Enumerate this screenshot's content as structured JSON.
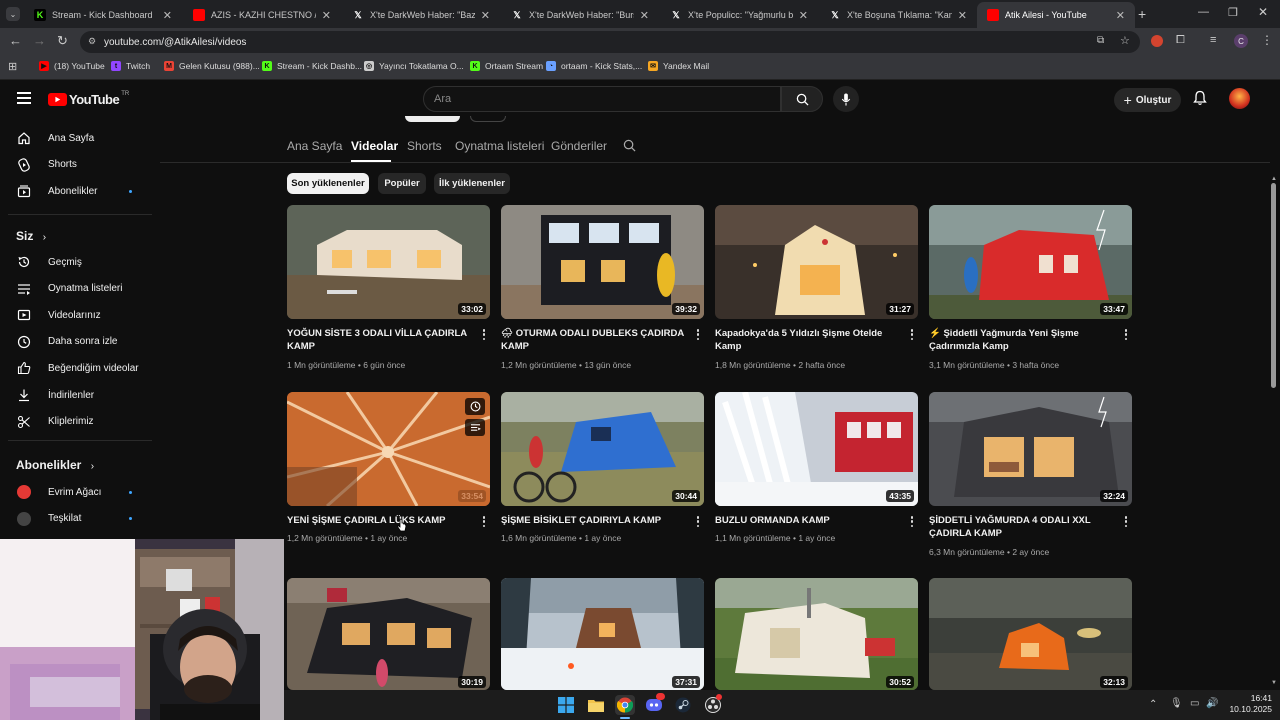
{
  "browser": {
    "tabs": [
      {
        "title": "Stream - Kick Dashboard",
        "icon": "kick-icon",
        "color": "#53fc18"
      },
      {
        "title": "AZIS - KAZHI CHESTNO / АЗИС",
        "icon": "youtube-icon",
        "color": "#ff0000"
      },
      {
        "title": "X'te DarkWeb Haber: \"Bazı me",
        "icon": "x-icon",
        "color": "#ffffff"
      },
      {
        "title": "X'te DarkWeb Haber: \"Bursa'da",
        "icon": "x-icon",
        "color": "#ffffff"
      },
      {
        "title": "X'te Populicc: \"Yağmurlu bir gü",
        "icon": "x-icon",
        "color": "#ffffff"
      },
      {
        "title": "X'te Boşuna Tıklama: \"Kamp vi",
        "icon": "x-icon",
        "color": "#ffffff"
      },
      {
        "title": "Atik Ailesi - YouTube",
        "icon": "youtube-icon",
        "color": "#ff0000",
        "active": true
      }
    ],
    "url": "youtube.com/@AtikAilesi/videos",
    "bookmarks": [
      {
        "label": "(18) YouTube",
        "color": "#ff0000",
        "glyph": "▶"
      },
      {
        "label": "Twitch",
        "color": "#9146ff",
        "glyph": "t"
      },
      {
        "label": "Gelen Kutusu (988)...",
        "color": "#ea4335",
        "glyph": "M"
      },
      {
        "label": "Stream - Kick Dashb...",
        "color": "#53fc18",
        "glyph": "K"
      },
      {
        "label": "Yayıncı Tokatlama O...",
        "color": "#cccccc",
        "glyph": "◎"
      },
      {
        "label": "Ortaam Stream",
        "color": "#53fc18",
        "glyph": "K"
      },
      {
        "label": "ortaam - Kick Stats,...",
        "color": "#6aa0ff",
        "glyph": "◔"
      },
      {
        "label": "Yandex Mail",
        "color": "#f5a623",
        "glyph": "✉"
      }
    ]
  },
  "youtube": {
    "logo_text": "YouTube",
    "logo_suffix": "TR",
    "search_placeholder": "Ara",
    "create_label": "Oluştur"
  },
  "sidebar": {
    "main": [
      {
        "label": "Ana Sayfa",
        "icon": "home-icon"
      },
      {
        "label": "Shorts",
        "icon": "shorts-icon"
      },
      {
        "label": "Abonelikler",
        "icon": "subscriptions-icon",
        "dot": true
      }
    ],
    "you_heading": "Siz",
    "you": [
      {
        "label": "Geçmiş",
        "icon": "history-icon"
      },
      {
        "label": "Oynatma listeleri",
        "icon": "playlists-icon"
      },
      {
        "label": "Videolarınız",
        "icon": "your-videos-icon"
      },
      {
        "label": "Daha sonra izle",
        "icon": "watch-later-icon"
      },
      {
        "label": "Beğendiğim videolar",
        "icon": "liked-icon"
      },
      {
        "label": "İndirilenler",
        "icon": "downloads-icon"
      },
      {
        "label": "Kliplerimiz",
        "icon": "clips-icon"
      }
    ],
    "subs_heading": "Abonelikler",
    "subs": [
      {
        "label": "Evrim Ağacı",
        "color": "#e53935",
        "dot": true
      },
      {
        "label": "Teşkilat",
        "color": "#444444",
        "dot": true
      }
    ]
  },
  "channel": {
    "tabs": [
      "Ana Sayfa",
      "Videolar",
      "Shorts",
      "Oynatma listeleri",
      "Gönderiler"
    ],
    "active_tab": "Videolar",
    "chips": [
      "Son yüklenenler",
      "Popüler",
      "İlk yüklenenler"
    ],
    "active_chip": "Son yüklenenler"
  },
  "videos": [
    {
      "title": "YOĞUN SİSTE 3 ODALI VİLLA ÇADIRLA KAMP",
      "views": "1 Mn görüntüleme",
      "age": "6 gün önce",
      "duration": "33:02"
    },
    {
      "title": "🌧 OTURMA ODALI DUBLEKS ÇADIRDA KAMP",
      "views": "1,2 Mn görüntüleme",
      "age": "13 gün önce",
      "duration": "39:32"
    },
    {
      "title": "Kapadokya'da 5 Yıldızlı Şişme Otelde Kamp",
      "views": "1,8 Mn görüntüleme",
      "age": "2 hafta önce",
      "duration": "31:27"
    },
    {
      "title": "⚡ Şiddetli Yağmurda Yeni Şişme Çadırımızla Kamp",
      "views": "3,1 Mn görüntüleme",
      "age": "3 hafta önce",
      "duration": "33:47"
    },
    {
      "title": "YENİ ŞİŞME ÇADIRLA LÜKS KAMP",
      "views": "1,2 Mn görüntüleme",
      "age": "1 ay önce",
      "duration": "33:54"
    },
    {
      "title": "ŞİŞME BİSİKLET ÇADIRIYLA KAMP",
      "views": "1,6 Mn görüntüleme",
      "age": "1 ay önce",
      "duration": "30:44"
    },
    {
      "title": "BUZLU ORMANDA KAMP",
      "views": "1,1 Mn görüntüleme",
      "age": "1 ay önce",
      "duration": "43:35"
    },
    {
      "title": "ŞİDDETLİ YAĞMURDA 4 ODALI XXL ÇADIRLA KAMP",
      "views": "6,3 Mn görüntüleme",
      "age": "2 ay önce",
      "duration": "32:24"
    },
    {
      "title": "",
      "views": "",
      "age": "",
      "duration": "30:19"
    },
    {
      "title": "",
      "views": "",
      "age": "",
      "duration": "37:31"
    },
    {
      "title": "",
      "views": "",
      "age": "",
      "duration": "30:52"
    },
    {
      "title": "",
      "views": "",
      "age": "",
      "duration": "32:13"
    }
  ],
  "system": {
    "time": "16:41",
    "date": "10.10.2025"
  }
}
